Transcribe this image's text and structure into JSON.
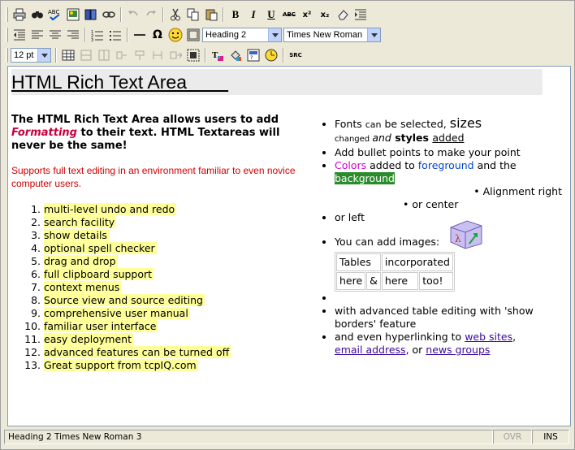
{
  "toolbar": {
    "buttons_row1": [
      "print-icon",
      "find-icon",
      "spell-check-icon",
      "image-icon",
      "dictionary-icon",
      "link-icon",
      "undo-icon",
      "redo-icon",
      "cut-icon",
      "copy-icon",
      "paste-icon",
      "bold-icon",
      "italic-icon",
      "underline-icon",
      "strikethrough-icon",
      "superscript-icon",
      "subscript-icon",
      "eraser-icon",
      "indent-icon"
    ],
    "bold_label": "B",
    "italic_label": "I",
    "underline_label": "U",
    "strike_label": "ABC",
    "sup_label": "x²",
    "sub_label": "x₂",
    "omega_label": "Ω",
    "style_select": "Heading 2",
    "font_select": "Times New Roman",
    "size_select": "12 pt",
    "src_label": "SRC"
  },
  "editor": {
    "heading": "HTML Rich Text Area        ",
    "intro_a": "The HTML Rich Text Area allows users to add ",
    "intro_em": "Formatting",
    "intro_b": " to their text. HTML Textareas will never be the same!",
    "support": "Supports full text editing in an environment familiar to even novice computer users.",
    "features": [
      "multi-level undo and redo",
      "search facility",
      "show details",
      "optional spell checker",
      "drag and drop",
      "full clipboard support",
      "context menus",
      "Source view and source editing",
      "comprehensive user manual",
      "familiar user interface",
      "easy deployment",
      "advanced features can be turned off",
      "Great support from tcpIQ.com"
    ],
    "right": {
      "fonts_a": "Fonts ",
      "fonts_can": "can",
      "fonts_b": " be selected, ",
      "fonts_sizes": "sizes",
      "fonts_changed": "changed ",
      "fonts_and": "and",
      "fonts_styles": " styles ",
      "fonts_added": "added",
      "bullets": "Add bullet points to make your point",
      "colors_word": "Colors",
      "colors_b": " added to ",
      "colors_fg": "foreground",
      "colors_c": " and the ",
      "colors_bg": "background",
      "align_right": "Alignment right",
      "align_center": "or center",
      "or_left": "or left",
      "images": "You can add images:",
      "table": [
        [
          "Tables",
          "incorporated"
        ],
        [
          "here",
          "&",
          "here",
          "too!"
        ]
      ],
      "table_edit": "with advanced table editing with 'show borders' feature",
      "links_a": "and even hyperlinking to ",
      "link_web": "web sites",
      "links_b": ",",
      "link_email": "email address",
      "links_c": ", or ",
      "link_news": "news groups"
    }
  },
  "status": {
    "main": "Heading 2 Times New Roman 3",
    "ovr": "OVR",
    "ins": "INS"
  }
}
